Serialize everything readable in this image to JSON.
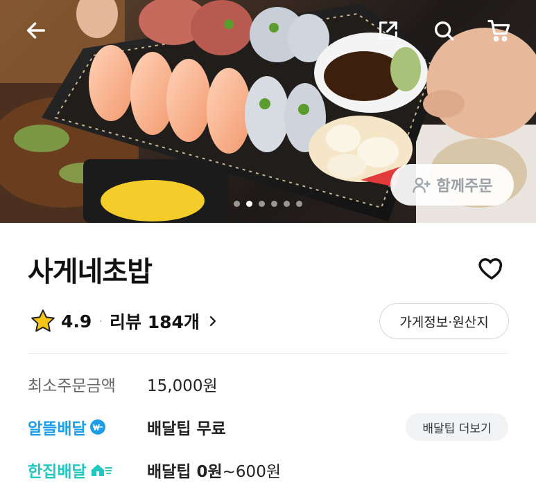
{
  "store": {
    "name": "사게네초밥",
    "rating": "4.9",
    "review_text": "리뷰 184개",
    "info_button": "가게정보·원산지"
  },
  "hero": {
    "together_order": "함께주문",
    "dots_total": 6,
    "dots_active_index": 1
  },
  "info_rows": {
    "min_order_label": "최소주문금액",
    "min_order_value": "15,000원",
    "al_delivery_label": "알뜰배달",
    "al_delivery_value": "배달팁 무료",
    "tip_more_button": "배달팁 더보기",
    "han_delivery_label": "한집배달",
    "han_delivery_value_bold": "배달팁 0원",
    "han_delivery_value_rest": "~600원"
  },
  "colors": {
    "al_delivery": "#1f9ee8",
    "han_delivery": "#20c8c0",
    "star": "#f5c518"
  },
  "icons": [
    "back-arrow-icon",
    "share-icon",
    "search-icon",
    "cart-icon",
    "add-person-icon",
    "heart-icon",
    "star-icon",
    "chevron-right-icon",
    "won-badge-icon",
    "home-delivery-icon"
  ]
}
